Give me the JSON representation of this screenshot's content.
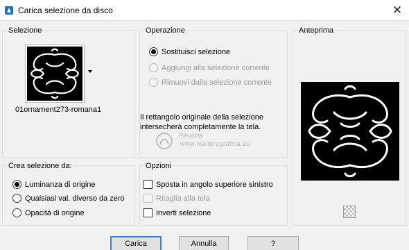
{
  "window": {
    "title": "Carica selezione da disco",
    "close_symbol": "✕",
    "icon": "app-icon"
  },
  "selezione": {
    "label": "Selezione",
    "file_name": "01ornament273-romana1"
  },
  "operazione": {
    "label": "Operazione",
    "options": [
      {
        "label": "Sostituisci selezione",
        "checked": true,
        "enabled": true
      },
      {
        "label": "Aggiungi alla selezione corrente",
        "checked": false,
        "enabled": false
      },
      {
        "label": "Rimuovi dalla selezione corrente",
        "checked": false,
        "enabled": false
      }
    ],
    "info": "Il rettangolo originale della selezione intersecherà completamente la tela."
  },
  "anteprima": {
    "label": "Anteprima"
  },
  "crea": {
    "label": "Crea selezione da:",
    "options": [
      {
        "label": "Luminanza di origine",
        "checked": true
      },
      {
        "label": "Qualsiasi val. diverso da zero",
        "checked": false
      },
      {
        "label": "Opacità di origine",
        "checked": false
      }
    ]
  },
  "opzioni": {
    "label": "Opzioni",
    "items": [
      {
        "label": "Sposta in angolo superiore sinistro",
        "checked": false,
        "enabled": true
      },
      {
        "label": "Ritaglia alla tela",
        "checked": false,
        "enabled": false
      },
      {
        "label": "Inverti selezione",
        "checked": false,
        "enabled": true
      }
    ]
  },
  "watermark": {
    "line1": "Pinuccia",
    "line2": "www.maidiregrafica.eu"
  },
  "buttons": {
    "carica": "Carica",
    "annulla": "Annulla",
    "help": "?"
  },
  "colors": {
    "accent": "#3c7fd8",
    "dialog_bg": "#f0f0f0",
    "disabled_text": "#9a9a9a"
  }
}
